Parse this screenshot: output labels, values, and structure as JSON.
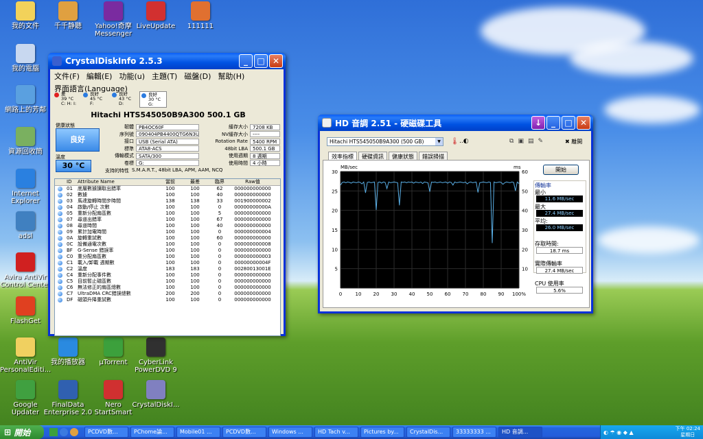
{
  "desktop_icons": [
    {
      "label": "我的文件",
      "color": "#f2d25a"
    },
    {
      "label": "千千静聽",
      "color": "#e0a040"
    },
    {
      "label": "Yahoo!奇摩 Messenger",
      "color": "#7a2ba0"
    },
    {
      "label": "LiveUpdate",
      "color": "#d23030"
    },
    {
      "label": "111111",
      "color": "#e07030"
    },
    {
      "label": "我的電腦",
      "color": "#c8d8f0"
    },
    {
      "label": "網路上的芳鄰",
      "color": "#5aa0e0"
    },
    {
      "label": "資源回收筒",
      "color": "#7ab060"
    },
    {
      "label": "Internet Explorer",
      "color": "#2a80e0"
    },
    {
      "label": "adsl",
      "color": "#4080c0"
    },
    {
      "label": "Avira AntiVir Control Center",
      "color": "#d02020"
    },
    {
      "label": "FlashGet",
      "color": "#e04020"
    },
    {
      "label": "AntiVir PersonalEditi...",
      "color": "#f0d060"
    },
    {
      "label": "我的播放器",
      "color": "#2a8ae0"
    },
    {
      "label": "µTorrent",
      "color": "#3ca03c"
    },
    {
      "label": "CyberLink PowerDVD 9",
      "color": "#303030"
    },
    {
      "label": "Google Updater",
      "color": "#40a040"
    },
    {
      "label": "FinalData Enterprise 2.0",
      "color": "#3060b0"
    },
    {
      "label": "Nero StartSmart",
      "color": "#d03030"
    },
    {
      "label": "CrystalDiskI...",
      "color": "#8080c0"
    }
  ],
  "cdi": {
    "title": "CrystalDiskInfo 2.5.3",
    "menu": [
      "文件(F)",
      "編輯(E)",
      "功能(u)",
      "主題(T)",
      "磁盤(D)",
      "幫助(H)"
    ],
    "menu2": "界面語言(Language)",
    "drives": [
      {
        "status": "差",
        "temp": "39 °C",
        "letter": "C: H: I:",
        "color": "#e02020"
      },
      {
        "status": "良好",
        "temp": "45 °C",
        "letter": "F:",
        "color": "#2b7be0"
      },
      {
        "status": "良好",
        "temp": "43 °C",
        "letter": "D:",
        "color": "#2b7be0"
      },
      {
        "status": "良好",
        "temp": "30 °C",
        "letter": "G:",
        "color": "#2b7be0"
      }
    ],
    "model": "Hitachi HTS545050B9A300  500.1 GB",
    "health_label": "健康狀態",
    "health": "良好",
    "temp_label": "溫度",
    "temp": "30 °C",
    "left_fields": [
      {
        "k": "韌體",
        "v": "PB4OC60F"
      },
      {
        "k": "序列號",
        "v": "090404PB4400QTG6N3UA"
      },
      {
        "k": "接口",
        "v": "USB (Serial ATA)"
      },
      {
        "k": "標準",
        "v": "ATA8-ACS"
      },
      {
        "k": "傳輸模式",
        "v": "SATA/300"
      },
      {
        "k": "卷標",
        "v": "G:"
      }
    ],
    "right_fields": [
      {
        "k": "緩存大小",
        "v": "7208 KB"
      },
      {
        "k": "NV緩存大小",
        "v": "----"
      },
      {
        "k": "Rotation Rate",
        "v": "5400 RPM"
      },
      {
        "k": "48bit LBA",
        "v": "500.1 GB"
      },
      {
        "k": "使用週期",
        "v": "8 週期"
      },
      {
        "k": "使用時間",
        "v": "4 小時"
      }
    ],
    "features_label": "支持的特性",
    "features": "S.M.A.R.T., 48bit LBA, APM, AAM, NCQ",
    "columns": [
      "ID",
      "Attribute Name",
      "當前",
      "最差",
      "臨界",
      "Raw值"
    ],
    "rows": [
      [
        "01",
        "底層數據讀取出錯率",
        "100",
        "100",
        "62",
        "000000000000"
      ],
      [
        "02",
        "數據",
        "100",
        "100",
        "40",
        "000000000000"
      ],
      [
        "03",
        "馬達旋轉時間步時間",
        "138",
        "138",
        "33",
        "001900000002"
      ],
      [
        "04",
        "啟動/停止 次數",
        "100",
        "100",
        "0",
        "00000000000A"
      ],
      [
        "05",
        "重新分配扇區數",
        "100",
        "100",
        "5",
        "000000000000"
      ],
      [
        "07",
        "尋道出錯率",
        "100",
        "100",
        "67",
        "000000000000"
      ],
      [
        "08",
        "尋道時間",
        "100",
        "100",
        "40",
        "000000000000"
      ],
      [
        "09",
        "累計加電時間",
        "100",
        "100",
        "0",
        "000000000004"
      ],
      [
        "0A",
        "旋轉重試數",
        "100",
        "100",
        "60",
        "000000000000"
      ],
      [
        "0C",
        "設備通電次數",
        "100",
        "100",
        "0",
        "000000000008"
      ],
      [
        "BF",
        "G-Sense 錯誤率",
        "100",
        "100",
        "0",
        "000000000000"
      ],
      [
        "C0",
        "重分配扇區數",
        "100",
        "100",
        "0",
        "000000000003"
      ],
      [
        "C1",
        "載入/卸載 週期數",
        "100",
        "100",
        "0",
        "00000000004F"
      ],
      [
        "C2",
        "溫度",
        "183",
        "183",
        "0",
        "00280013001E"
      ],
      [
        "C4",
        "重新分配事件數",
        "100",
        "100",
        "0",
        "000000000000"
      ],
      [
        "C5",
        "目前暫止磁區數",
        "100",
        "100",
        "0",
        "000000000000"
      ],
      [
        "C6",
        "無法修正的扇區總數",
        "100",
        "100",
        "0",
        "000000000000"
      ],
      [
        "C7",
        "UltraDMA CRC錯誤總數",
        "200",
        "200",
        "0",
        "000000000000"
      ],
      [
        "DF",
        "磁頭升降重試數",
        "100",
        "100",
        "0",
        "000000000000"
      ]
    ]
  },
  "hdtune": {
    "title": "HD 音調 2.51 - 硬磁碟工具",
    "drive": "Hitachi HTS545050B9A300 (500 GB)",
    "exit": "離開",
    "tabs": [
      "效率指標",
      "硬碟資訊",
      "健康狀態",
      "錯誤掃描"
    ],
    "start": "開始",
    "y_left_label": "MB/sec",
    "y_right_label": "ms",
    "transfer_label": "傳輸率",
    "min_label": "最小",
    "min": "11.6 MB/sec",
    "max_label": "最大",
    "max": "27.4 MB/sec",
    "avg_label": "平均:",
    "avg": "26.0 MB/sec",
    "access_label": "存取時間:",
    "access": "18.7 ms",
    "burst_label": "實際傳輸率",
    "burst": "27.4 MB/sec",
    "cpu_label": "CPU 使用率",
    "cpu": "5.6%",
    "chart_data": {
      "type": "line",
      "xlabel": "",
      "ylabel": "MB/sec",
      "y2label": "ms",
      "x_ticks": [
        "0",
        "10",
        "20",
        "30",
        "40",
        "50",
        "60",
        "70",
        "80",
        "90",
        "100%"
      ],
      "y_ticks": [
        "30",
        "25",
        "20",
        "15",
        "10",
        "5"
      ],
      "y2_ticks": [
        "60",
        "50",
        "40",
        "30",
        "20",
        "10"
      ],
      "ylim": [
        0,
        30
      ],
      "y2lim": [
        0,
        60
      ],
      "series": [
        {
          "name": "",
          "color": "#5ab0e8",
          "values": [
            26.5,
            27.2,
            27.3,
            27.1,
            27.3,
            27.2,
            27.0,
            27.3,
            27.2,
            27.1,
            27.3,
            27.2,
            26.8,
            27.3,
            24.5,
            27.2,
            27.3,
            27.1,
            27.2,
            27.3,
            20.1,
            27.2,
            27.3,
            27.0,
            27.3,
            27.2,
            25.6,
            27.3,
            27.1,
            27.2,
            27.3,
            27.2,
            27.1,
            21.3,
            27.3,
            27.2,
            27.3,
            27.1,
            27.3,
            27.2,
            27.3,
            27.0,
            27.3,
            27.2,
            27.1,
            27.3,
            26.9,
            27.3,
            27.2,
            27.1,
            24.8,
            27.3,
            27.2,
            27.3,
            27.1,
            27.2,
            27.3,
            27.1,
            27.2,
            27.3,
            27.0,
            27.3,
            27.2,
            26.5,
            27.3,
            27.1,
            27.2,
            27.3,
            27.2,
            27.1,
            27.3,
            26.8,
            27.2,
            27.3,
            27.1,
            27.2,
            27.3,
            24.6,
            27.1,
            27.2,
            27.3,
            27.2,
            27.1,
            27.3,
            27.2,
            11.6,
            27.3,
            27.1,
            27.2,
            27.3,
            27.2,
            26.7,
            27.1,
            27.3,
            27.2,
            27.1,
            27.3,
            27.2,
            25.0,
            27.3,
            26.9
          ]
        }
      ]
    }
  },
  "taskbar": {
    "start": "開始",
    "tasks": [
      "PCDVD數...",
      "PChome論...",
      "Mobile01 ...",
      "PCDVD數...",
      "Windows ...",
      "HD Tach v...",
      "Pictures by...",
      "CrystalDis...",
      "33333333 ...",
      "HD 音調..."
    ],
    "clock": "下午 02:24",
    "day": "星期日"
  }
}
